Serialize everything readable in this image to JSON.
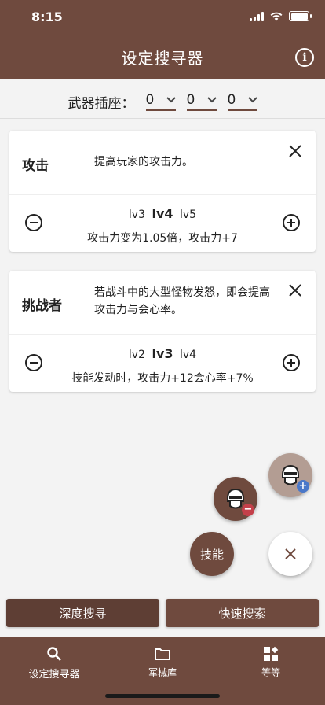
{
  "status_bar": {
    "time": "8:15"
  },
  "header": {
    "title": "设定搜寻器",
    "info_icon": "info-icon",
    "info_glyph": "i"
  },
  "slots": {
    "label": "武器插座：",
    "values": [
      "0",
      "0",
      "0"
    ]
  },
  "skills": [
    {
      "name": "攻击",
      "description": "提高玩家的攻击力。",
      "level_prev": "lv3",
      "level_current": "lv4",
      "level_next": "lv5",
      "effect": "攻击力变为1.05倍，攻击力+7"
    },
    {
      "name": "挑战者",
      "description": "若战斗中的大型怪物发怒，即会提高攻击力与会心率。",
      "level_prev": "lv2",
      "level_current": "lv3",
      "level_next": "lv4",
      "effect": "技能发动时，攻击力+12会心率+7%"
    }
  ],
  "fabs": {
    "skill_label": "技能",
    "add_armor_icon": "armor-add-icon",
    "remove_armor_icon": "armor-remove-icon",
    "close_icon": "close-icon"
  },
  "search_buttons": {
    "deep": "深度搜寻",
    "quick": "快速搜索"
  },
  "bottom_nav": [
    {
      "label": "设定搜寻器",
      "icon": "search-icon",
      "active": true
    },
    {
      "label": "军械库",
      "icon": "folder-icon",
      "active": false
    },
    {
      "label": "等等",
      "icon": "widgets-icon",
      "active": false
    }
  ],
  "colors": {
    "primary": "#6f4a3e",
    "primary_dark": "#5e3e34",
    "fab_light": "#b39d93",
    "background": "#f3f3f3"
  }
}
